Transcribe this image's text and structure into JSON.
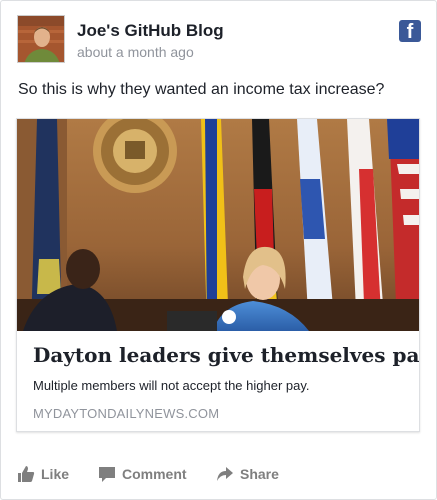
{
  "post": {
    "author": "Joe's GitHub Blog",
    "timestamp": "about a month ago",
    "message": "So this is why they wanted an income tax increase?"
  },
  "facebook_icon": {
    "glyph": "f",
    "color": "#3b5998"
  },
  "link_preview": {
    "title": "Dayton leaders give themselves pay ...",
    "description": "Multiple members will not accept the higher pay.",
    "source": "MYDAYTONDAILYNEWS.COM"
  },
  "actions": {
    "like": "Like",
    "comment": "Comment",
    "share": "Share"
  },
  "icons": [
    "facebook-icon",
    "like-icon",
    "comment-icon",
    "share-icon"
  ]
}
